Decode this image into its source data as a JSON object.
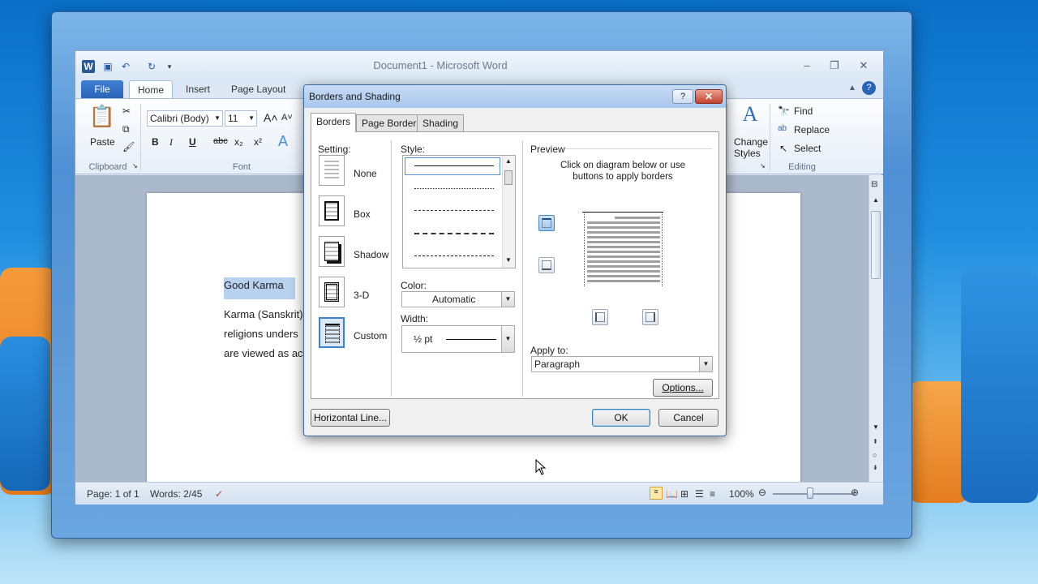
{
  "window": {
    "title": "Document1  -  Microsoft Word"
  },
  "quick_access": {
    "icons": [
      "word-logo-icon",
      "save-icon",
      "undo-icon",
      "redo-icon",
      "customize-icon"
    ]
  },
  "ribbon_tabs": [
    "File",
    "Home",
    "Insert",
    "Page Layout"
  ],
  "ribbon": {
    "clipboard": {
      "paste_label": "Paste",
      "group_label": "Clipboard"
    },
    "font": {
      "font_name": "Calibri (Body)",
      "font_size": "11",
      "group_label": "Font",
      "bold": "B",
      "italic": "I",
      "underline": "U",
      "strike": "abc",
      "subscript": "x₂",
      "superscript": "x²"
    },
    "styles": {
      "change_styles_line1": "Change",
      "change_styles_line2": "Styles"
    },
    "editing": {
      "find_label": "Find",
      "replace_label": "Replace",
      "select_label": "Select",
      "group_label": "Editing"
    }
  },
  "document": {
    "heading": "Good Karma",
    "lines": [
      "Karma (Sanskrit)",
      "religions unders",
      "are viewed as ac"
    ]
  },
  "status_bar": {
    "page": "Page: 1 of 1",
    "words": "Words: 2/45",
    "zoom": "100%"
  },
  "dialog": {
    "title": "Borders and Shading",
    "help_label": "?",
    "close_label": "✕",
    "tabs": [
      "Borders",
      "Page Border",
      "Shading"
    ],
    "setting_label": "Setting:",
    "settings": [
      "None",
      "Box",
      "Shadow",
      "3-D",
      "Custom"
    ],
    "selected_setting": "Custom",
    "style_label": "Style:",
    "color_label": "Color:",
    "color_value": "Automatic",
    "width_label": "Width:",
    "width_value": "½ pt",
    "preview_label": "Preview",
    "preview_hint": "Click on diagram below or use buttons to apply borders",
    "apply_to_label": "Apply to:",
    "apply_to_value": "Paragraph",
    "options_button": "Options...",
    "horizontal_line_button": "Horizontal Line...",
    "ok_button": "OK",
    "cancel_button": "Cancel"
  },
  "colors": {
    "accent": "#2a64b8",
    "selection": "#b7d2ef",
    "close_red": "#c5412b"
  }
}
